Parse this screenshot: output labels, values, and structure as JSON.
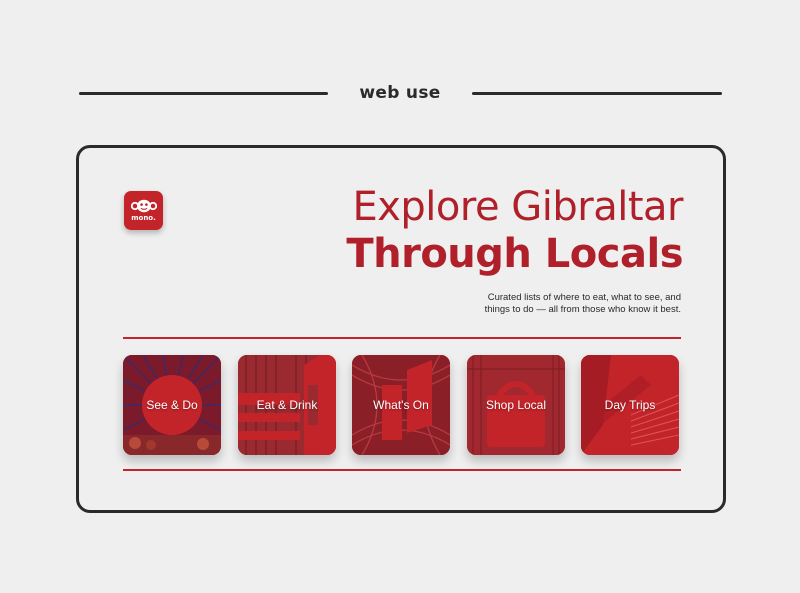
{
  "section_title": "web use",
  "brand": {
    "name": "mono.",
    "color": "#c3242a",
    "icon": "monkey-face-icon"
  },
  "hero": {
    "title_line1": "Explore Gibraltar",
    "title_line2": "Through Locals",
    "subtitle_line1": "Curated lists of where to eat, what to see, and",
    "subtitle_line2": "things to do — all from those who know it best."
  },
  "categories": [
    {
      "label": "See & Do"
    },
    {
      "label": "Eat & Drink"
    },
    {
      "label": "What's On"
    },
    {
      "label": "Shop Local"
    },
    {
      "label": "Day Trips"
    }
  ],
  "colors": {
    "accent": "#c3242a",
    "dark": "#2a2a2a",
    "background": "#efefef"
  }
}
